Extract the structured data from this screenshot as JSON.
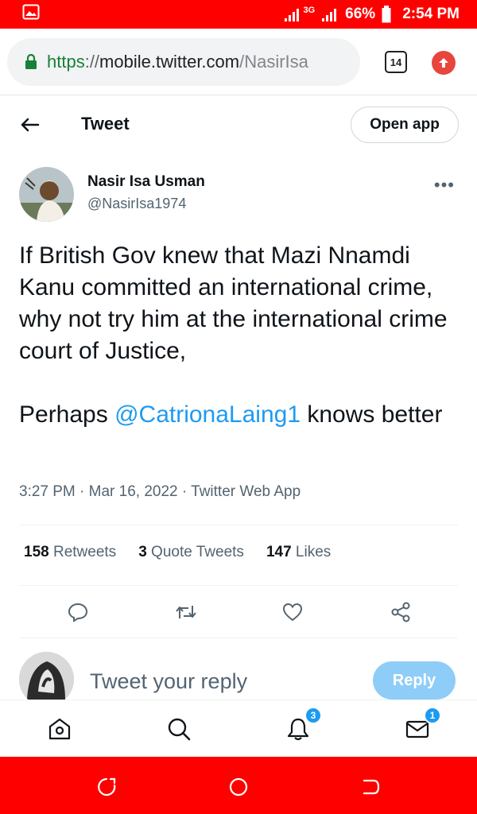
{
  "status_bar": {
    "network": "3G",
    "battery": "66%",
    "time": "2:54 PM"
  },
  "browser": {
    "url_scheme": "https",
    "url_separator": "://",
    "url_host": "mobile.twitter.com",
    "url_path": "/NasirIsa",
    "tab_count": "14"
  },
  "header": {
    "title": "Tweet",
    "open_app_label": "Open app"
  },
  "tweet": {
    "author_name": "Nasir Isa Usman",
    "author_handle": "@NasirIsa1974",
    "paragraph1": "If British Gov knew that Mazi Nnamdi Kanu committed an international crime, why not try him at the international crime court of Justice,",
    "paragraph2_before": "Perhaps ",
    "mention": "@CatrionaLaing1",
    "paragraph2_after": " knows better",
    "meta": "3:27 PM · Mar 16, 2022 · Twitter Web App",
    "retweets_count": "158",
    "retweets_label": "Retweets",
    "quotes_count": "3",
    "quotes_label": "Quote Tweets",
    "likes_count": "147",
    "likes_label": "Likes"
  },
  "reply": {
    "placeholder": "Tweet your reply",
    "button_label": "Reply"
  },
  "bottom_nav": {
    "notifications_badge": "3",
    "messages_badge": "1"
  },
  "icons": {
    "gallery": "image-icon",
    "lock": "lock-icon",
    "update": "arrow-up-icon",
    "back": "arrow-left-icon",
    "more": "more-icon",
    "reply": "comment-icon",
    "retweet": "retweet-icon",
    "like": "heart-icon",
    "share": "share-icon"
  },
  "colors": {
    "status_bar": "#ff0000",
    "link": "#1d9bf0",
    "reply_button": "#8ecdf8"
  }
}
